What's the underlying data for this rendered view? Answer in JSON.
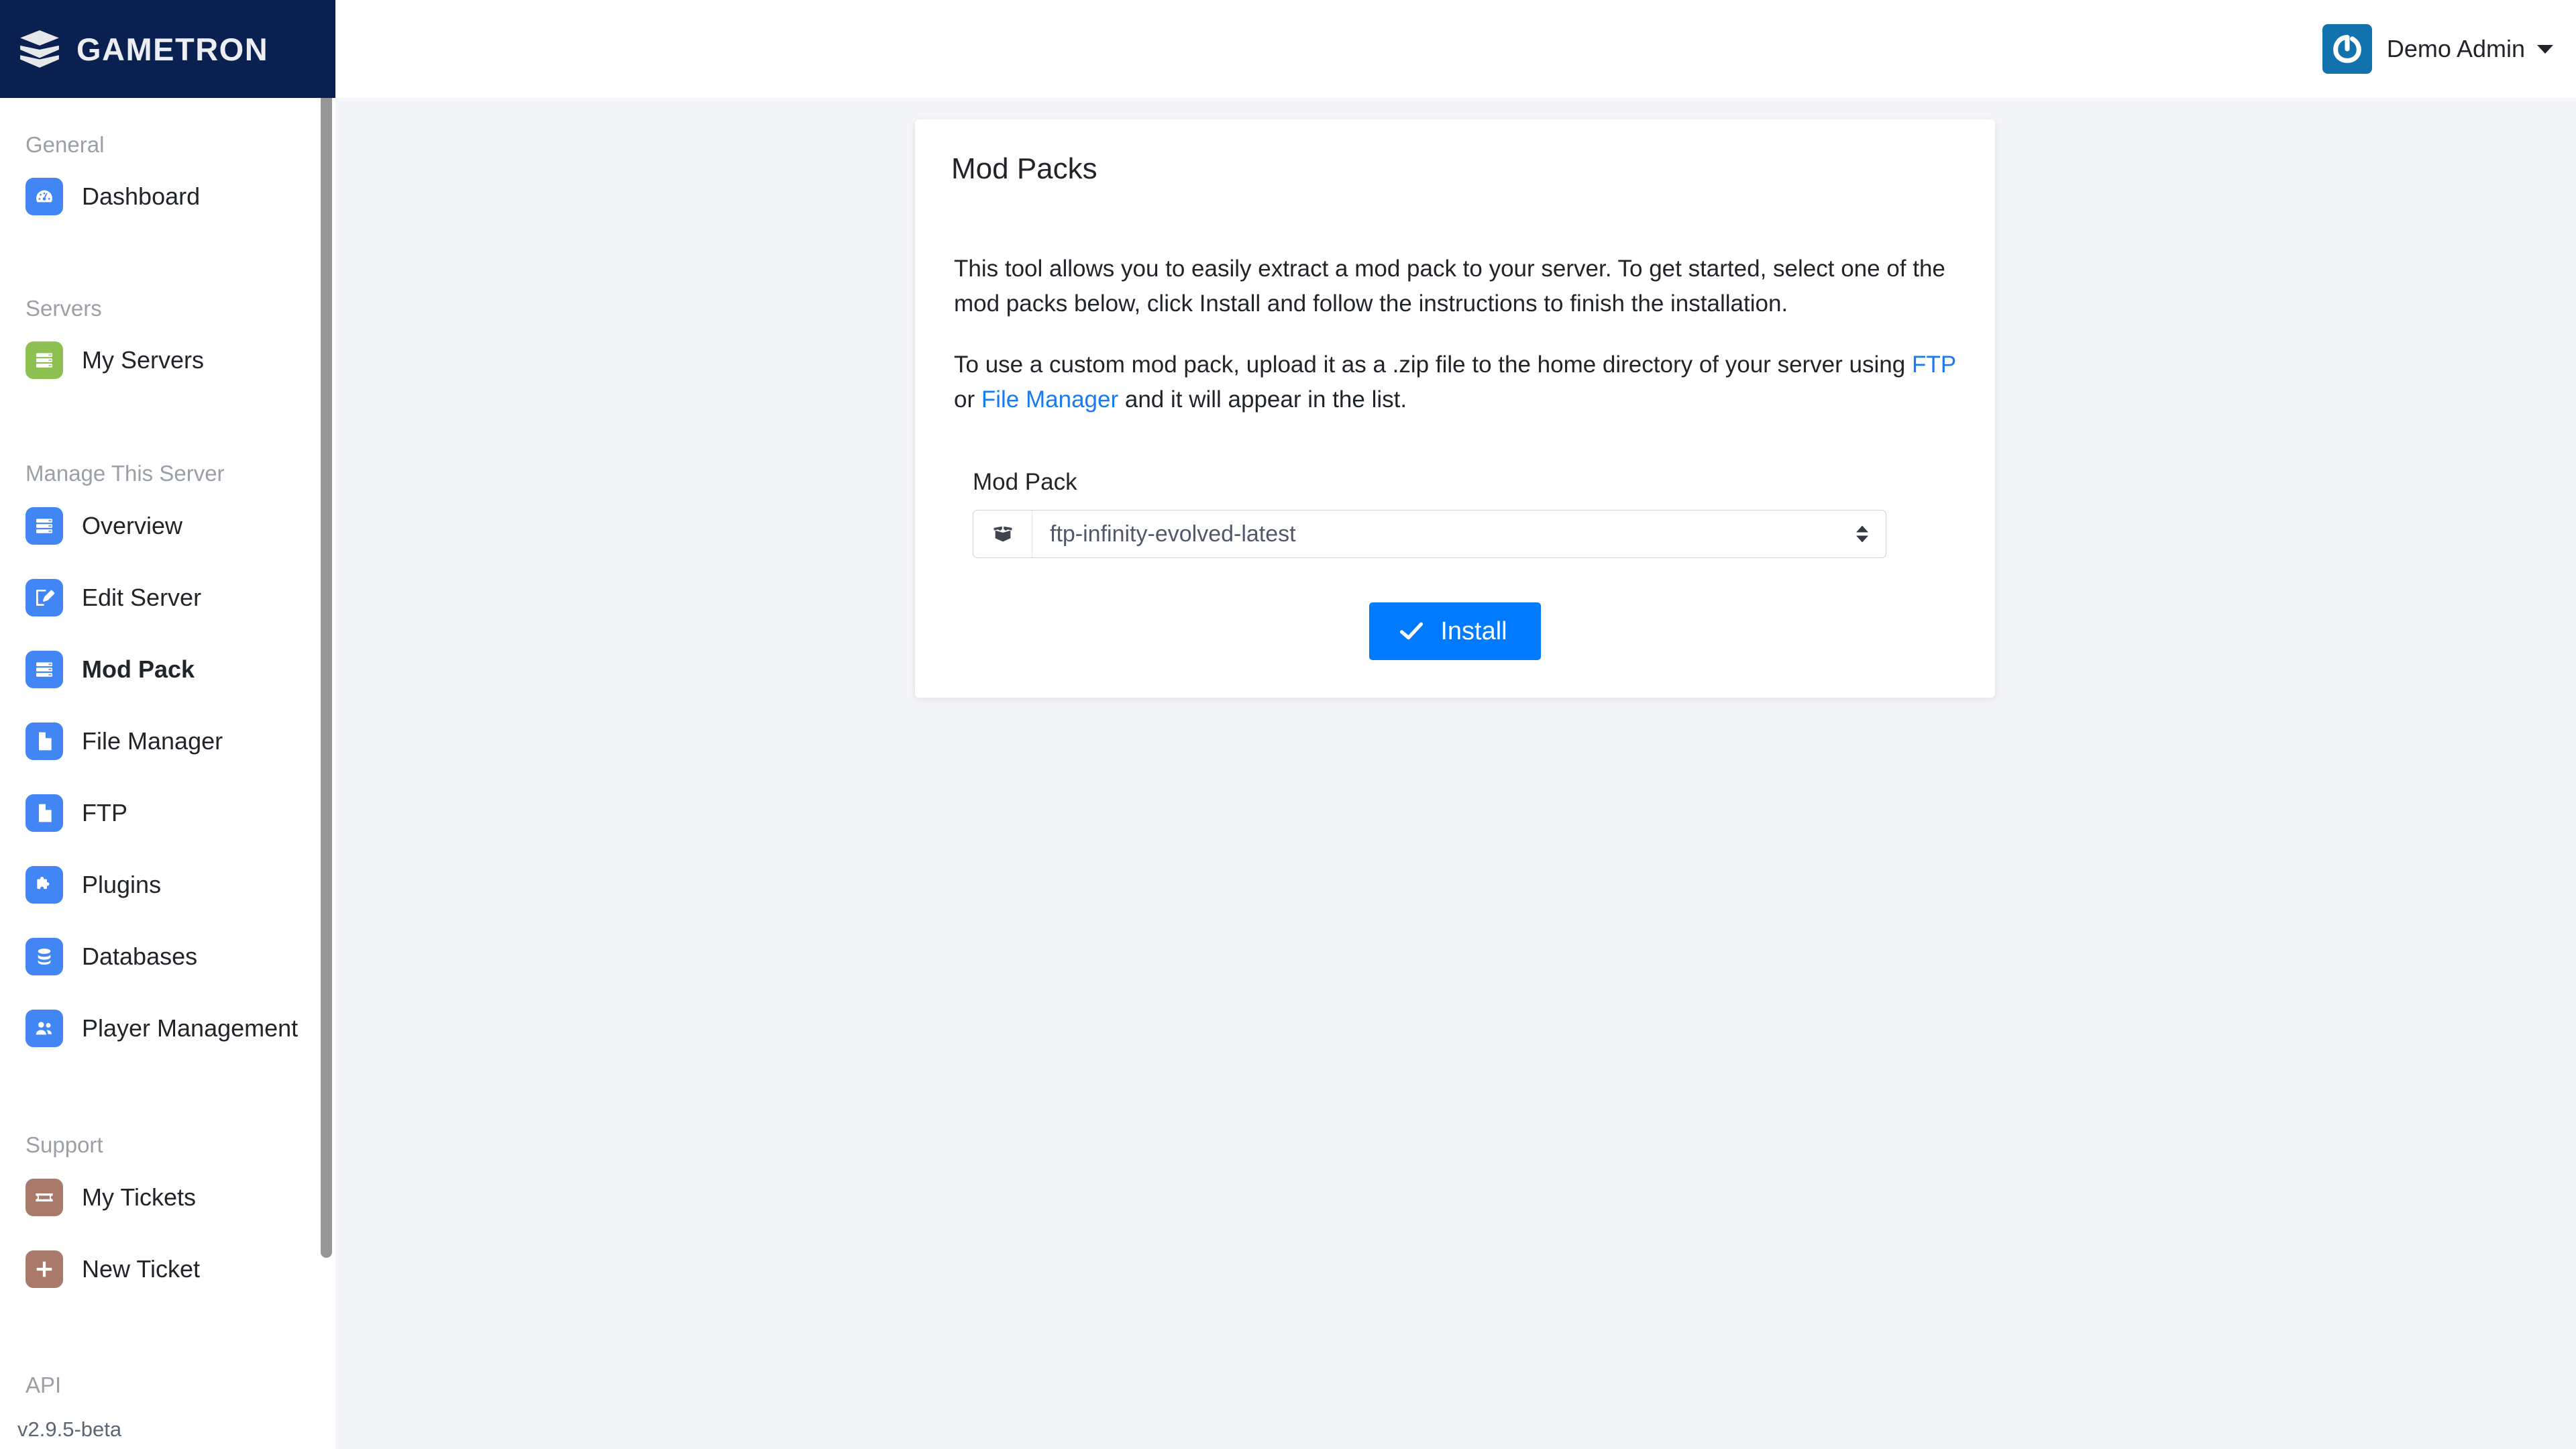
{
  "brand": {
    "name": "GAMETRON",
    "logo_icon": "stacked-layers-icon"
  },
  "header": {
    "user_name": "Demo Admin",
    "avatar_icon": "power-logo-icon",
    "caret_icon": "chevron-down-icon"
  },
  "sidebar": {
    "sections": [
      {
        "label": "General",
        "items": [
          {
            "label": "Dashboard",
            "icon": "speedometer-icon",
            "color": "#4285f4",
            "active": false
          }
        ]
      },
      {
        "label": "Servers",
        "items": [
          {
            "label": "My Servers",
            "icon": "server-rack-icon",
            "color": "#8cc152",
            "active": false
          }
        ]
      },
      {
        "label": "Manage This Server",
        "items": [
          {
            "label": "Overview",
            "icon": "server-rack-icon",
            "color": "#4285f4",
            "active": false
          },
          {
            "label": "Edit Server",
            "icon": "pencil-square-icon",
            "color": "#4285f4",
            "active": false
          },
          {
            "label": "Mod Pack",
            "icon": "server-rack-icon",
            "color": "#4285f4",
            "active": true
          },
          {
            "label": "File Manager",
            "icon": "file-icon",
            "color": "#4285f4",
            "active": false
          },
          {
            "label": "FTP",
            "icon": "file-icon",
            "color": "#4285f4",
            "active": false
          },
          {
            "label": "Plugins",
            "icon": "puzzle-piece-icon",
            "color": "#4285f4",
            "active": false
          },
          {
            "label": "Databases",
            "icon": "database-icon",
            "color": "#4285f4",
            "active": false
          },
          {
            "label": "Player Management",
            "icon": "users-icon",
            "color": "#4285f4",
            "active": false
          }
        ]
      },
      {
        "label": "Support",
        "items": [
          {
            "label": "My Tickets",
            "icon": "ticket-icon",
            "color": "#a9796a",
            "active": false
          },
          {
            "label": "New Ticket",
            "icon": "plus-icon",
            "color": "#a9796a",
            "active": false
          }
        ]
      },
      {
        "label": "API",
        "items": []
      }
    ],
    "version": "v2.9.5-beta"
  },
  "card": {
    "title": "Mod Packs",
    "paragraph1": "This tool allows you to easily extract a mod pack to your server. To get started, select one of the mod packs below, click Install and follow the instructions to finish the installation.",
    "paragraph2_part1": "To use a custom mod pack, upload it as a .zip file to the home directory of your server using ",
    "link_ftp": "FTP",
    "paragraph2_part2": " or ",
    "link_file_manager": "File Manager",
    "paragraph2_part3": " and it will appear in the list.",
    "form": {
      "label": "Mod Pack",
      "addon_icon": "open-box-icon",
      "selected_value": "ftp-infinity-evolved-latest",
      "options": [
        "ftp-infinity-evolved-latest"
      ]
    },
    "install_button": {
      "label": "Install",
      "icon": "check-icon"
    }
  },
  "colors": {
    "brand_navy": "#0a2050",
    "accent_blue": "#007bff",
    "link_blue": "#1a7bf0",
    "icon_blue": "#4285f4",
    "icon_green": "#8cc152",
    "icon_brown": "#a9796a",
    "page_bg": "#f4f5f8"
  }
}
